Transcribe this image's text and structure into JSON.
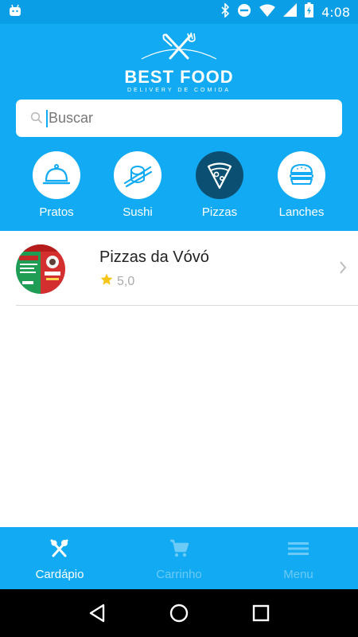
{
  "status_bar": {
    "time": "4:08",
    "battery_level": "charging"
  },
  "brand": {
    "title": "BEST FOOD",
    "subtitle": "DELIVERY DE COMIDA"
  },
  "search": {
    "placeholder": "Buscar",
    "value": ""
  },
  "categories": [
    {
      "label": "Pratos",
      "icon": "cloche-icon",
      "active": false
    },
    {
      "label": "Sushi",
      "icon": "sushi-icon",
      "active": false
    },
    {
      "label": "Pizzas",
      "icon": "pizza-icon",
      "active": true
    },
    {
      "label": "Lanches",
      "icon": "burger-icon",
      "active": false
    }
  ],
  "restaurants": [
    {
      "name": "Pizzas da Vóvó",
      "rating": "5,0"
    }
  ],
  "bottom_nav": [
    {
      "label": "Cardápio",
      "icon": "fork-knife-icon",
      "active": true
    },
    {
      "label": "Carrinho",
      "icon": "cart-icon",
      "active": false
    },
    {
      "label": "Menu",
      "icon": "hamburger-menu-icon",
      "active": false
    }
  ],
  "colors": {
    "primary": "#12aaf2",
    "status": "#0a9ee6",
    "active_category": "#0b4f73",
    "star": "#f5c518"
  }
}
